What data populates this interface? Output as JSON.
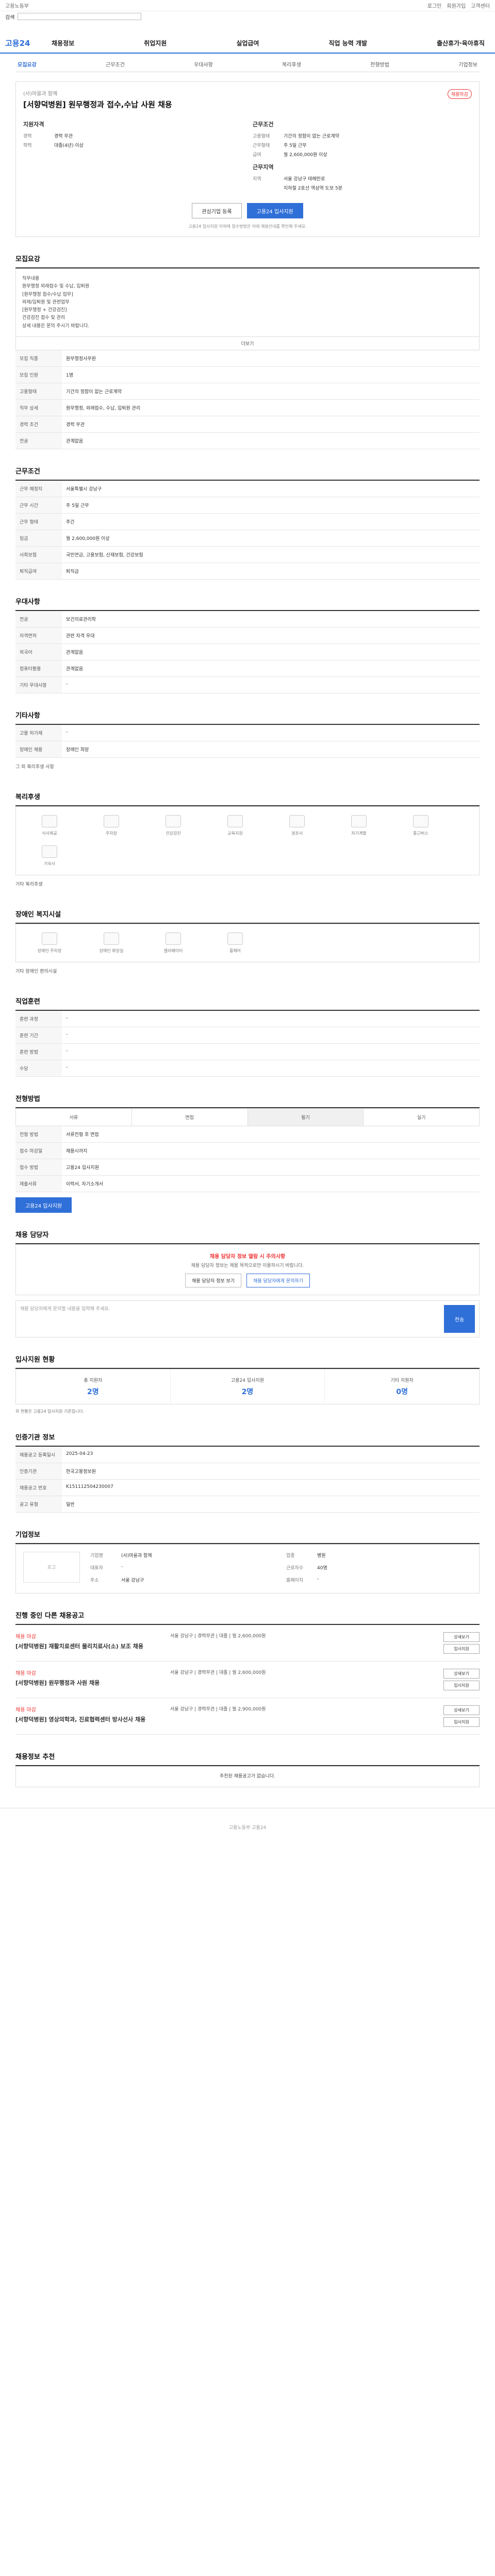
{
  "topbar": {
    "left": "고용노동부",
    "links": [
      "로그인",
      "회원가입",
      "고객센터"
    ]
  },
  "search": {
    "label": "검색",
    "placeholder": ""
  },
  "gnb": {
    "logo": "고용24",
    "menu": [
      "채용정보",
      "취업지원",
      "실업급여",
      "직업 능력 개발",
      "출산휴가·육아휴직"
    ]
  },
  "tabs": [
    "모집요강",
    "근무조건",
    "우대사항",
    "복리후생",
    "전형방법",
    "기업정보"
  ],
  "job": {
    "company": "(사)마을과 함께",
    "title": "[서향덕병원] 원무행정과 접수,수납 사원 채용",
    "badge": "채용마감",
    "req_head": "지원자격",
    "req": [
      [
        "경력",
        "경력 무관"
      ],
      [
        "학력",
        "대졸(4년) 이상"
      ]
    ],
    "cond_head": "근무조건",
    "cond": [
      [
        "고용형태",
        "기간의 정함이 없는 근로계약"
      ],
      [
        "근무형태",
        "주 5일 근무"
      ],
      [
        "급여",
        "월 2,600,000원 이상"
      ]
    ],
    "place_head": "근무지역",
    "place": [
      [
        "지역",
        "서울 강남구 테헤란로"
      ],
      [
        "",
        "지하철 2호선 역삼역 도보 5분"
      ]
    ],
    "btn_scrap": "관심기업 등록",
    "btn_apply": "고용24 입사지원",
    "notice": "고용24 입사지원 이외에 접수방법은 아래 채용안내를 확인해 주세요."
  },
  "s1": {
    "title": "모집요강",
    "body": "직무내용\n원무행정 외래접수 및 수납, 입퇴원\n[원무행정 접수/수납 업무]\n외래/입퇴원 및 관련업무\n[원무행정 + 건강검진]\n건강검진 접수 및 관리\n상세 내용은 문의 주시기 바랍니다.",
    "more": "더보기",
    "rows": [
      [
        "모집 직종",
        "원무행정사무원"
      ],
      [
        "모집 인원",
        "1명"
      ],
      [
        "고용형태",
        "기간의 정함이 없는 근로계약"
      ],
      [
        "직무 상세",
        "원무행정, 외래접수, 수납, 입퇴원 관리"
      ],
      [
        "경력 조건",
        "경력 무관"
      ],
      [
        "전공",
        "관계없음"
      ]
    ]
  },
  "s2": {
    "title": "근무조건",
    "rows": [
      [
        "근무 예정지",
        "서울특별시 강남구"
      ],
      [
        "근무 시간",
        "주 5일 근무"
      ],
      [
        "근무 형태",
        "주간"
      ],
      [
        "임금",
        "월 2,600,000원 이상"
      ],
      [
        "사회보험",
        "국민연금, 고용보험, 산재보험, 건강보험"
      ],
      [
        "퇴직급여",
        "퇴직금"
      ]
    ]
  },
  "s3": {
    "title": "우대사항",
    "rows": [
      [
        "전공",
        "보건의료관리학"
      ],
      [
        "자격면허",
        "관련 자격 우대"
      ],
      [
        "외국어",
        "관계없음"
      ],
      [
        "컴퓨터활용",
        "관계없음"
      ],
      [
        "기타 우대사항",
        "-"
      ]
    ]
  },
  "s4": {
    "title": "기타사항",
    "rows": [
      [
        "고용 허가제",
        "-"
      ],
      [
        "장애인 채용",
        "장애인 희망"
      ]
    ],
    "etc": "그 외 복리후생 사항"
  },
  "s5": {
    "title": "복리후생",
    "icons": [
      "식사제공",
      "주차장",
      "건강검진",
      "교육지원",
      "경조사",
      "자기계발",
      "통근버스",
      "기숙사"
    ],
    "etc": "기타 복리후생"
  },
  "s6": {
    "title": "장애인 복지시설",
    "icons": [
      "장애인 주차장",
      "장애인 화장실",
      "엘리베이터",
      "휠체어"
    ],
    "etc": "기타 장애인 편의시설"
  },
  "s7": {
    "title": "직업훈련",
    "rows": [
      [
        "훈련 과정",
        "-"
      ],
      [
        "훈련 기간",
        "-"
      ],
      [
        "훈련 방법",
        "-"
      ],
      [
        "수당",
        "-"
      ]
    ]
  },
  "s8": {
    "title": "전형방법",
    "steps": [
      "서류",
      "면접",
      "필기",
      "실기"
    ],
    "rows": [
      [
        "전형 방법",
        "서류전형 후 면접"
      ],
      [
        "접수 마감일",
        "채용시까지"
      ],
      [
        "접수 방법",
        "고용24 입사지원"
      ],
      [
        "제출서류",
        "이력서, 자기소개서"
      ]
    ],
    "apply": "고용24 입사지원"
  },
  "s9": {
    "title": "채용 담당자",
    "warn": "채용 담당자 정보 열람 시 주의사항",
    "note": "채용 담당자 정보는 채용 목적으로만 이용하시기 바랍니다.",
    "btn1": "채용 담당자 정보 보기",
    "btn2": "채용 담당자에게 문의하기",
    "q_placeholder": "채용 담당자에게 문의할 내용을 입력해 주세요.",
    "send": "전송"
  },
  "s10": {
    "title": "입사지원 현황",
    "stats": [
      [
        "총 지원자",
        "2명"
      ],
      [
        "고용24 입사지원",
        "2명"
      ],
      [
        "기타 지원자",
        "0명"
      ]
    ],
    "note": "위 현황은 고용24 입사지원 기준입니다."
  },
  "s11": {
    "title": "인증기관 정보",
    "rows": [
      [
        "채용공고 등록일시",
        "2025-04-23"
      ],
      [
        "인증기관",
        "한국고용정보원"
      ],
      [
        "채용공고 번호",
        "K151112504230007"
      ],
      [
        "공고 유형",
        "일반"
      ]
    ]
  },
  "s12": {
    "title": "기업정보",
    "logo": "로고",
    "cols": [
      [
        "기업명",
        "(사)마을과 함께"
      ],
      [
        "업종",
        "병원"
      ],
      [
        "대표자",
        "-"
      ],
      [
        "근로자수",
        "40명"
      ],
      [
        "주소",
        "서울 강남구"
      ],
      [
        "홈페이지",
        "-"
      ]
    ]
  },
  "s13": {
    "title": "진행 중인 다른 채용공고",
    "items": [
      {
        "nm": "채용 마감",
        "tt": "[서향덕병원] 재활치료센터 물리치료사(소) 보조 채용",
        "m": "서울 강남구 | 경력무관 | 대졸 | 월 2,600,000원"
      },
      {
        "nm": "채용 마감",
        "tt": "[서향덕병원] 원무행정과 사원 채용",
        "m": "서울 강남구 | 경력무관 | 대졸 | 월 2,600,000원"
      },
      {
        "nm": "채용 마감",
        "tt": "[서향덕병원] 영상의학과, 진료협력센터 방사선사 채용",
        "m": "서울 강남구 | 경력무관 | 대졸 | 월 2,900,000원"
      }
    ],
    "btns": [
      "상세보기",
      "입사지원"
    ]
  },
  "s14": {
    "title": "채용정보 추천",
    "empty": "추천된 채용공고가 없습니다."
  },
  "footer": "고용노동부 고용24"
}
